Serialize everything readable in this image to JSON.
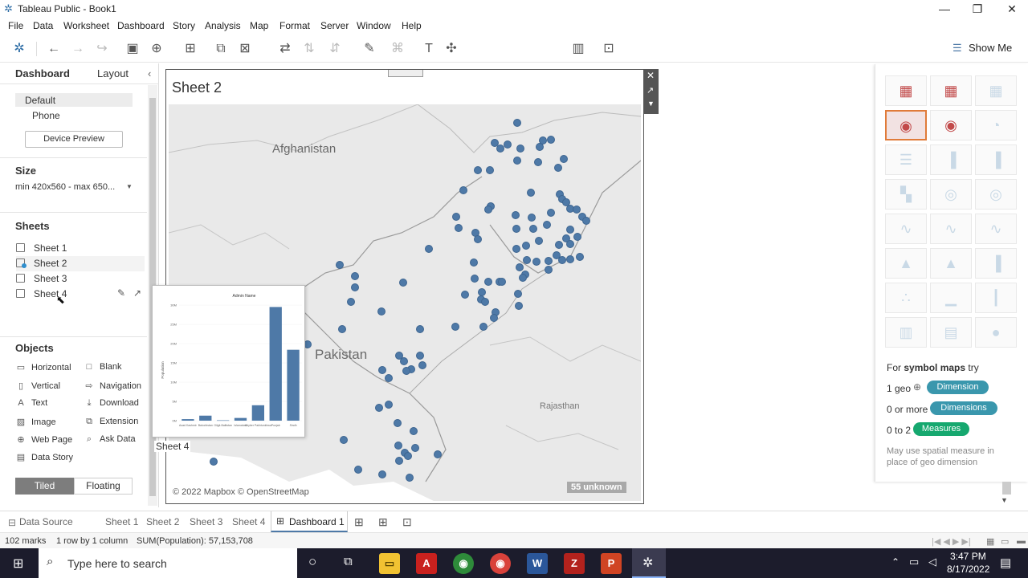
{
  "window": {
    "title": "Tableau Public - Book1",
    "controls": {
      "minimize": "—",
      "maximize": "❐",
      "close": "✕"
    }
  },
  "menu": [
    "File",
    "Data",
    "Worksheet",
    "Dashboard",
    "Story",
    "Analysis",
    "Map",
    "Format",
    "Server",
    "Window",
    "Help"
  ],
  "toolbar": {
    "show_me": "Show Me"
  },
  "left_panel": {
    "tabs": [
      "Dashboard",
      "Layout"
    ],
    "device": {
      "default": "Default",
      "phone": "Phone",
      "preview_button": "Device Preview"
    },
    "size": {
      "title": "Size",
      "value": "min 420x560 - max 650..."
    },
    "sheets_title": "Sheets",
    "sheets": [
      "Sheet 1",
      "Sheet 2",
      "Sheet 3",
      "Sheet 4"
    ],
    "objects_title": "Objects",
    "objects": [
      {
        "label": "Horizontal",
        "icon": "horizontal-icon"
      },
      {
        "label": "Blank",
        "icon": "blank-icon"
      },
      {
        "label": "Vertical",
        "icon": "vertical-icon"
      },
      {
        "label": "Navigation",
        "icon": "navigation-icon"
      },
      {
        "label": "Text",
        "icon": "text-icon"
      },
      {
        "label": "Download",
        "icon": "download-icon"
      },
      {
        "label": "Image",
        "icon": "image-icon"
      },
      {
        "label": "Extension",
        "icon": "extension-icon"
      },
      {
        "label": "Web Page",
        "icon": "globe-icon"
      },
      {
        "label": "Ask Data",
        "icon": "ask-data-icon"
      },
      {
        "label": "Data Story",
        "icon": "data-story-icon"
      }
    ],
    "layout_toggle": {
      "tiled": "Tiled",
      "floating": "Floating"
    }
  },
  "dashboard": {
    "sheet_title": "Sheet 2",
    "map_labels": {
      "afghanistan": "Afghanistan",
      "pakistan": "Pakistan",
      "rajasthan": "Rajasthan"
    },
    "attribution": "© 2022 Mapbox © OpenStreetMap",
    "unknown_badge": "55 unknown",
    "drag_preview_label": "Sheet 4",
    "drag_preview_chart_title": "Admin Name"
  },
  "chart_data": {
    "type": "bar",
    "title": "Admin Name",
    "ylabel": "Population",
    "y_ticks": [
      "30M",
      "25M",
      "20M",
      "15M",
      "10M",
      "5M",
      "0M"
    ],
    "categories": [
      "Azad Kashmir",
      "Balochistan",
      "Gilgit-Baltistan",
      "Islamabad",
      "Khyber Pakhtunkhwa",
      "Punjab",
      "Sindh"
    ],
    "values": [
      0.4,
      1.3,
      0.1,
      0.7,
      4.0,
      29.5,
      18.4
    ],
    "ylim": [
      0,
      30
    ]
  },
  "show_me": {
    "hint_prefix": "For",
    "hint_bold": "symbol maps",
    "hint_suffix": "try",
    "req": [
      {
        "count": "1 geo",
        "pill": "Dimension",
        "color": "#3a97ad"
      },
      {
        "count": "0 or more",
        "pill": "Dimensions",
        "color": "#3a97ad"
      },
      {
        "count": "0 to 2",
        "pill": "Measures",
        "color": "#16a86f"
      }
    ],
    "note": "May use spatial measure in place of geo dimension"
  },
  "bottom_tabs": [
    "Data Source",
    "Sheet 1",
    "Sheet 2",
    "Sheet 3",
    "Sheet 4",
    "Dashboard 1"
  ],
  "status": {
    "marks": "102 marks",
    "rows": "1 row by 1 column",
    "sum": "SUM(Population): 57,153,708"
  },
  "taskbar": {
    "search_placeholder": "Type here to search",
    "time": "3:47 PM",
    "date": "8/17/2022"
  },
  "colors": {
    "mark": "#4e79a7",
    "dimension": "#3a97ad",
    "measure": "#16a86f",
    "taskbar": "#1c1c2c"
  }
}
